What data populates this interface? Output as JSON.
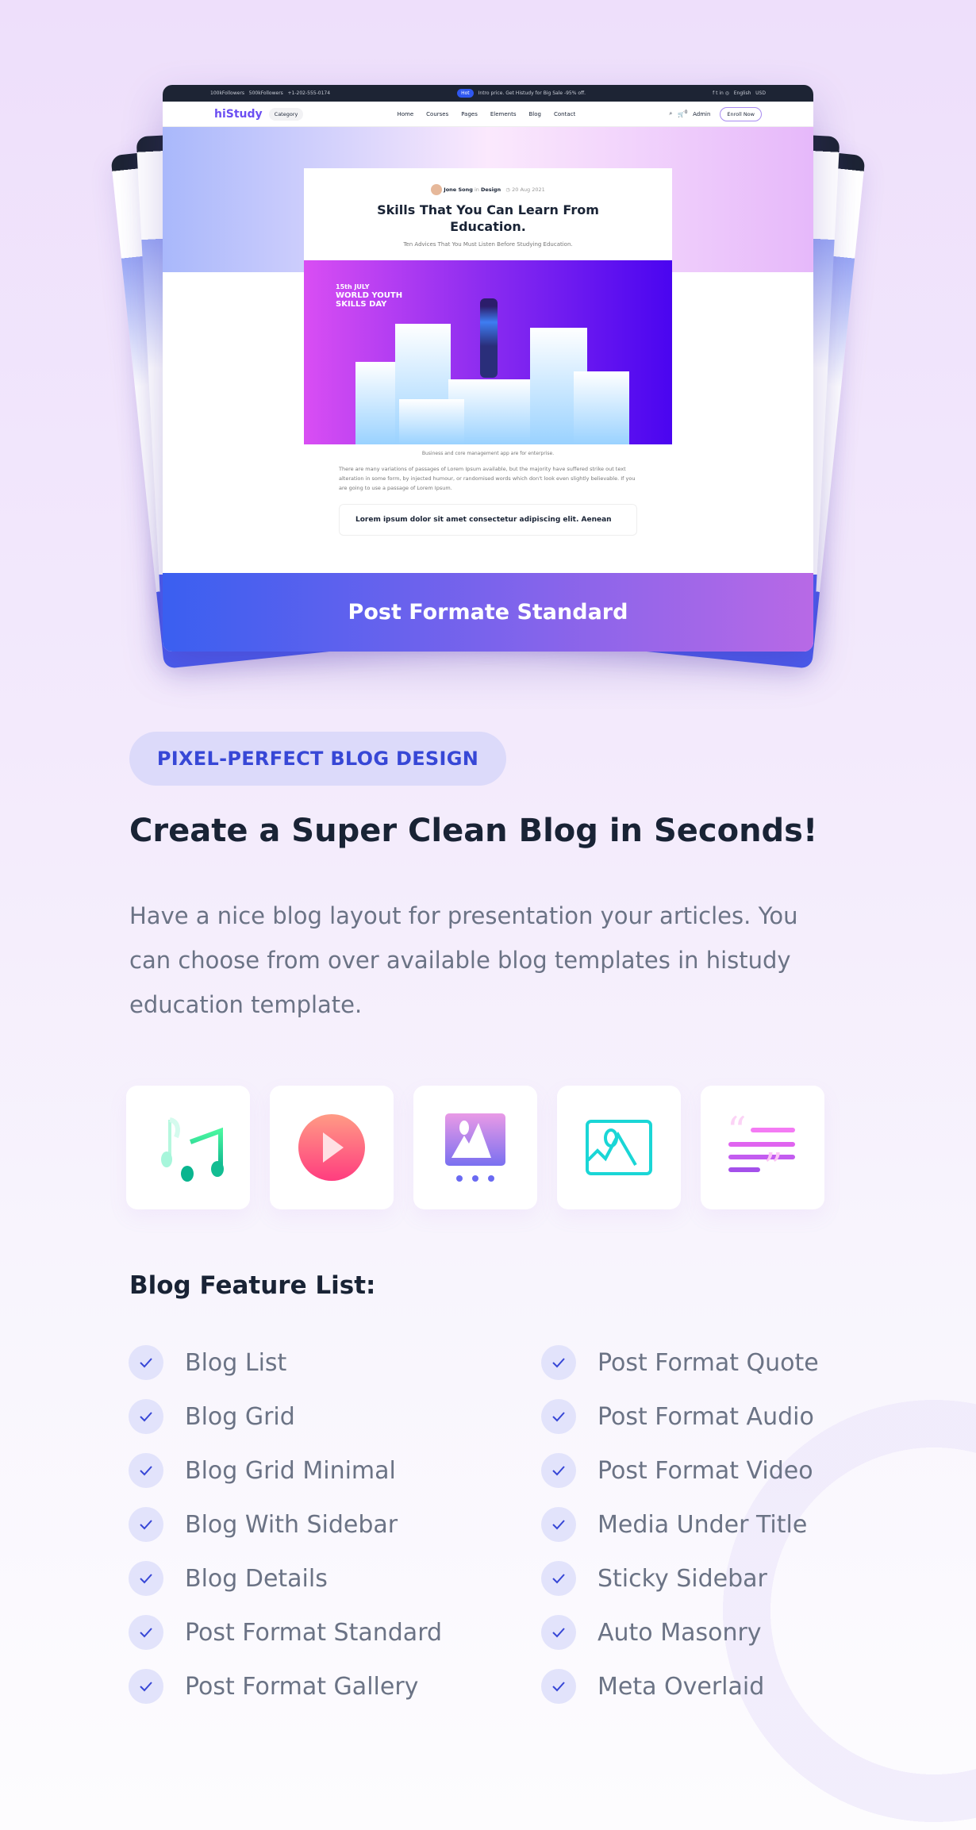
{
  "mockup": {
    "topbar": {
      "followers1": "100kFollowers",
      "followers2": "500kFollowers",
      "phone": "+1-202-555-0174",
      "hot": "Hot",
      "promo": "Intro price. Get Histudy for Big Sale -95% off.",
      "social": "f  t  in  ◎",
      "language": "English",
      "currency": "USD"
    },
    "nav": {
      "logo": "hiStudy",
      "category": "Category",
      "menu": [
        "Home",
        "Courses",
        "Pages",
        "Elements",
        "Blog",
        "Contact"
      ],
      "cart_count": "0",
      "user": "Admin",
      "enroll": "Enroll Now"
    },
    "article": {
      "author": "Jone Song",
      "in": "in",
      "category": "Design",
      "date": "20 Aug 2021",
      "title": "Skills That You Can Learn From Education.",
      "subtitle": "Ten Advices That You Must Listen Before Studying Education.",
      "image_text1": "15th JULY",
      "image_text2": "WORLD YOUTH",
      "image_text3": "SKILLS DAY",
      "caption": "Business and core management app are for enterprise.",
      "body": "There are many variations of passages of Lorem Ipsum available, but the majority have suffered strike out text alteration in some form, by injected humour, or randomised words which don't look even slightly believable. If you are going to use a passage of Lorem Ipsum.",
      "quote": "Lorem ipsum dolor sit amet consectetur adipiscing elit. Aenean"
    },
    "banner": "Post Formate Standard"
  },
  "badge": "PIXEL-PERFECT BLOG DESIGN",
  "heading": "Create a Super Clean Blog in Seconds!",
  "description": "Have a nice blog layout for presentation your articles. You can choose from over available blog templates in histudy education template.",
  "format_icons": [
    "audio-icon",
    "video-icon",
    "gallery-icon",
    "image-icon",
    "quote-icon"
  ],
  "feature_title": "Blog Feature List:",
  "features_left": [
    "Blog List",
    "Blog Grid",
    "Blog Grid Minimal",
    "Blog With Sidebar",
    "Blog Details",
    "Post Format Standard",
    "Post Format Gallery"
  ],
  "features_right": [
    "Post Format Quote",
    "Post Format Audio",
    "Post Format Video",
    "Media Under Title",
    "Sticky Sidebar",
    "Auto Masonry",
    "Meta Overlaid"
  ],
  "colors": {
    "accent": "#3747d6",
    "badge_bg": "#dcdafa",
    "heading": "#192335",
    "text": "#6b7385"
  }
}
